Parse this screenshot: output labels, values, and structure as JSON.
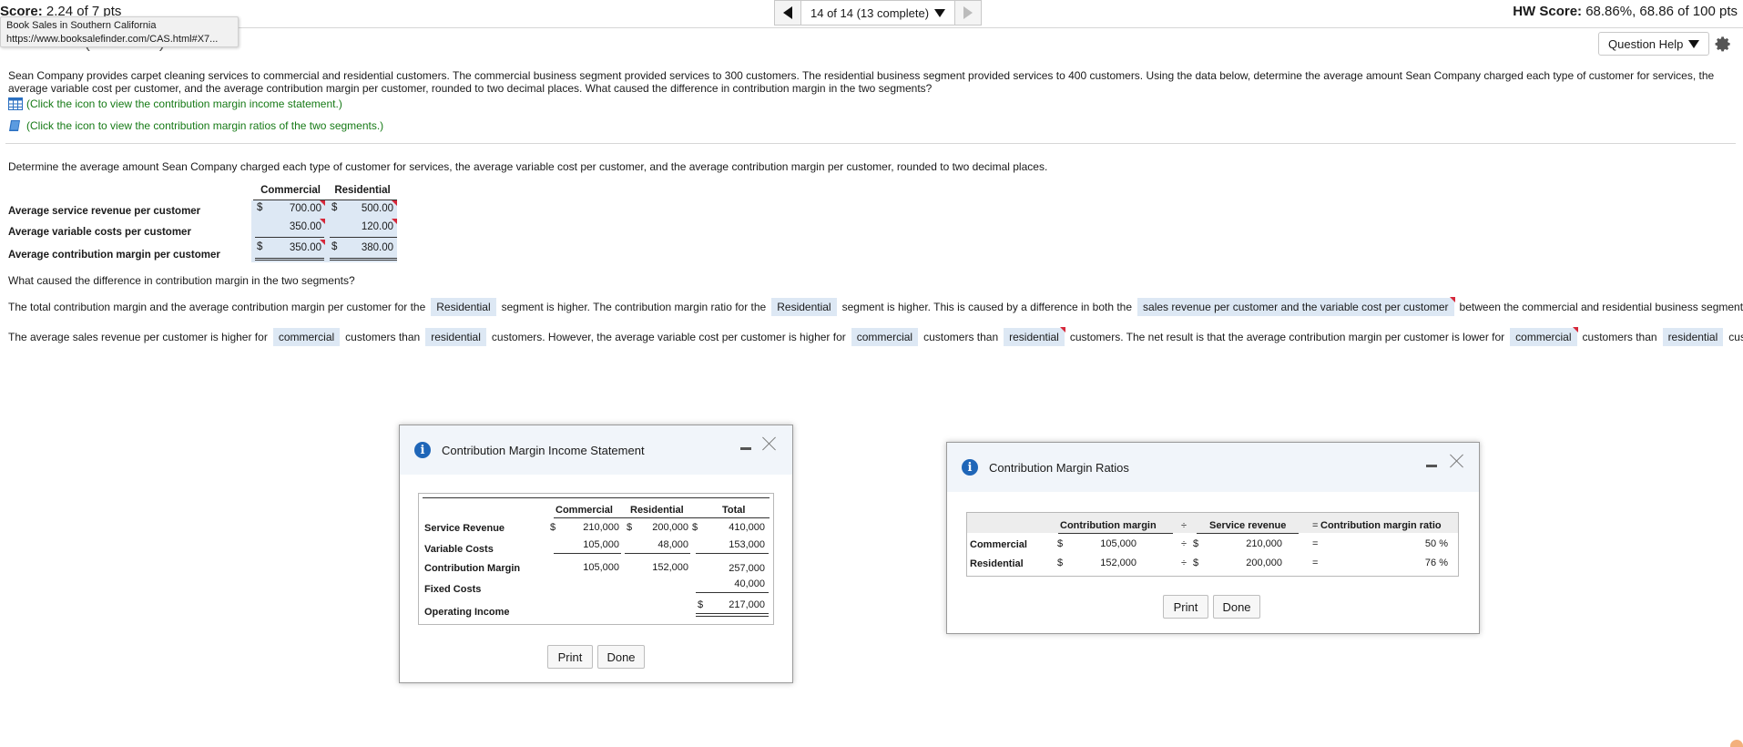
{
  "header": {
    "score_label": "Score:",
    "score_value": "2.24 of 7 pts",
    "nav_label": "14 of 14 (13 complete)",
    "hw_score_label": "HW Score:",
    "hw_score_value": "68.86%, 68.86 of 100 pts",
    "question_help": "Question Help",
    "partial_title": "E21-20 (similar to)"
  },
  "tooltip": {
    "title": "Book Sales in Southern California",
    "url": "https://www.booksalefinder.com/CAS.html#X7..."
  },
  "problem": {
    "text": "Sean Company provides carpet cleaning services to commercial and residential customers. The commercial business segment provided services to 300 customers. The residential business segment provided services to 400 customers. Using the data below, determine the average amount Sean Company charged each type of customer for services, the average variable cost per customer, and the average contribution margin per customer, rounded to two decimal places. What caused the difference in contribution margin in the two segments?",
    "link1": "(Click the icon to view the contribution margin income statement.)",
    "link2": "(Click the icon to view the contribution margin ratios of the two segments.)"
  },
  "instruction": "Determine the average amount Sean Company charged each type of customer for services, the average variable cost per customer, and the average contribution margin per customer, rounded to two decimal places.",
  "answer_table": {
    "col_commercial": "Commercial",
    "col_residential": "Residential",
    "row1_label": "Average service revenue per customer",
    "row2_label": "Average variable costs per customer",
    "row3_label": "Average contribution margin per customer",
    "currency": "$",
    "r1_commercial": "700.00",
    "r1_residential": "500.00",
    "r2_commercial": "350.00",
    "r2_residential": "120.00",
    "r3_commercial": "350.00",
    "r3_residential": "380.00"
  },
  "question2": "What caused the difference in contribution margin in the two segments?",
  "sentence1": {
    "p1": "The total contribution margin and the average contribution margin per customer for the",
    "b1": "Residential",
    "p2": "segment is higher. The contribution margin ratio for the",
    "b2": "Residential",
    "p3": "segment is higher. This is caused by a difference in both the",
    "b3": "sales revenue per customer and the variable cost per customer",
    "p4": "between the commercial and residential business segments."
  },
  "sentence2": {
    "p1": "The average sales revenue per customer is higher for",
    "b1": "commercial",
    "p2": "customers than",
    "b2": "residential",
    "p3": "customers. However, the average variable cost per customer is higher for",
    "b3": "commercial",
    "p4": "customers than",
    "b4": "residential",
    "p5": "customers. The net result is that the average contribution margin per customer is lower for",
    "b5": "commercial",
    "p6": "customers than",
    "b6": "residential",
    "p7": "customers."
  },
  "dialog_income": {
    "title": "Contribution Margin Income Statement",
    "col_commercial": "Commercial",
    "col_residential": "Residential",
    "col_total": "Total",
    "row_revenue": "Service Revenue",
    "row_variable": "Variable Costs",
    "row_cm": "Contribution Margin",
    "row_fixed": "Fixed Costs",
    "row_operating": "Operating Income",
    "currency": "$",
    "revenue_commercial": "210,000",
    "revenue_residential": "200,000",
    "revenue_total": "410,000",
    "variable_commercial": "105,000",
    "variable_residential": "48,000",
    "variable_total": "153,000",
    "cm_commercial": "105,000",
    "cm_residential": "152,000",
    "cm_total": "257,000",
    "fixed_total": "40,000",
    "operating_total": "217,000",
    "print": "Print",
    "done": "Done"
  },
  "dialog_ratios": {
    "title": "Contribution Margin Ratios",
    "col_cm": "Contribution margin",
    "div_sign": "÷",
    "col_revenue": "Service revenue",
    "eq_sign": "=",
    "col_ratio": "Contribution margin ratio",
    "row_commercial": "Commercial",
    "row_residential": "Residential",
    "currency": "$",
    "commercial_cm": "105,000",
    "commercial_revenue": "210,000",
    "commercial_ratio": "50 %",
    "residential_cm": "152,000",
    "residential_revenue": "200,000",
    "residential_ratio": "76 %",
    "print": "Print",
    "done": "Done"
  }
}
